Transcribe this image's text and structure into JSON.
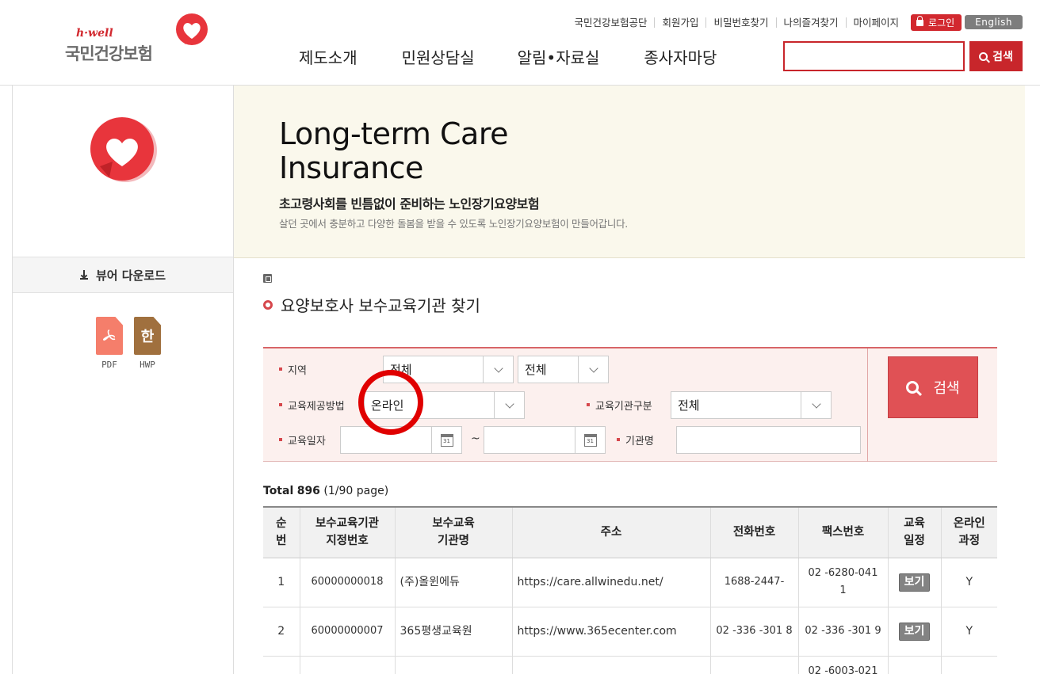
{
  "header": {
    "logo_small": "h·well",
    "logo_name": "국민건강보험",
    "util_links": [
      "국민건강보험공단",
      "회원가입",
      "비밀번호찾기",
      "나의즐겨찾기",
      "마이페이지"
    ],
    "login_label": "로그인",
    "english_label": "English",
    "gnb": [
      "제도소개",
      "민원상담실",
      "알림•자료실",
      "종사자마당"
    ],
    "search_placeholder": "",
    "search_label": "검색"
  },
  "sidebar": {
    "viewer_title": "뷰어 다운로드",
    "files": [
      {
        "label": "PDF",
        "icon": "pdf-file-icon"
      },
      {
        "label": "HWP",
        "icon": "hwp-file-icon",
        "glyph": "한"
      }
    ]
  },
  "banner": {
    "title_line1": "Long-term Care",
    "title_line2": "Insurance",
    "subtitle": "초고령사회를 빈틈없이 준비하는 노인장기요양보험",
    "description": "살던 곳에서 충분하고 다양한 돌봄을 받을 수 있도록 노인장기요양보험이 만들어갑니다."
  },
  "page": {
    "title": "요양보호사 보수교육기관 찾기"
  },
  "filter": {
    "region_label": "지역",
    "region1": "전체",
    "region2": "전체",
    "method_label": "교육제공방법",
    "method": "온라인",
    "org_type_label": "교육기관구분",
    "org_type": "전체",
    "date_label": "교육일자",
    "date_from": "",
    "date_to": "",
    "date_sep": "~",
    "org_name_label": "기관명",
    "org_name": "",
    "search_label": "검색"
  },
  "results": {
    "total_label": "Total",
    "total_count": "896",
    "page_info": "(1/90 page)",
    "columns": [
      [
        "순",
        "번"
      ],
      [
        "보수교육기관",
        "지정번호"
      ],
      [
        "보수교육",
        "기관명"
      ],
      [
        "주소"
      ],
      [
        "전화번호"
      ],
      [
        "팩스번호"
      ],
      [
        "교육",
        "일정"
      ],
      [
        "온라인",
        "과정"
      ]
    ],
    "view_label": "보기",
    "rows": [
      {
        "no": "1",
        "code": "60000000018",
        "name": "(주)올윈에듀",
        "addr": "https://care.allwinedu.net/",
        "tel": "1688-2447-",
        "fax": "02 -6280-041 1",
        "online": "Y"
      },
      {
        "no": "2",
        "code": "60000000007",
        "name": "365평생교육원",
        "addr": "https://www.365ecenter.com",
        "tel": "02 -336 -301 8",
        "fax": "02 -336 -301 9",
        "online": "Y"
      },
      {
        "no": "",
        "code": "",
        "name": "",
        "addr": "",
        "tel": "",
        "fax": "02 -6003-021",
        "online": ""
      }
    ]
  },
  "colors": {
    "brand_red": "#d2292f",
    "banner_bg": "#faf8ec",
    "filter_bg": "#fcf0ee",
    "highlight_ring": "#e00000"
  }
}
